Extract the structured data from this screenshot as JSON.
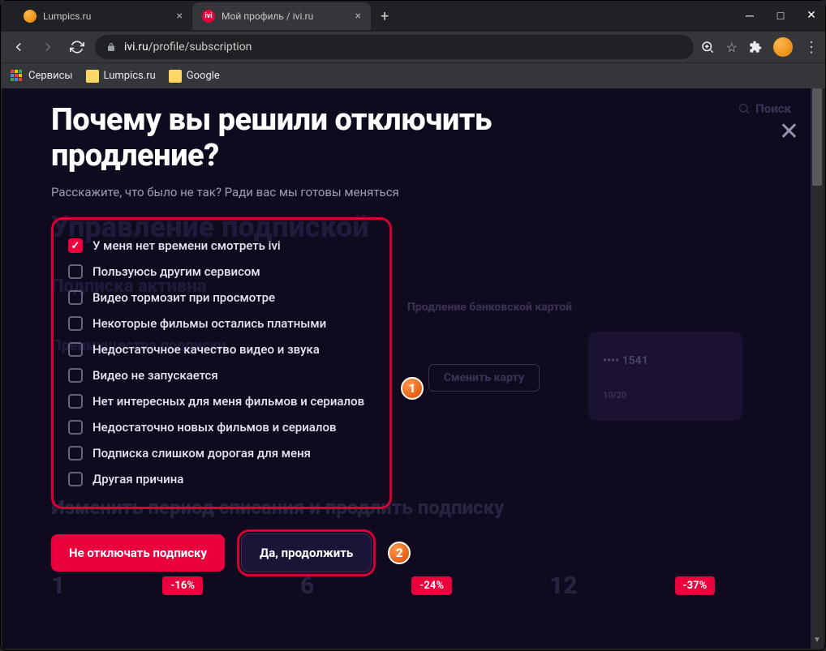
{
  "window": {
    "tabs": [
      {
        "title": "Lumpics.ru",
        "active": false
      },
      {
        "title": "Мой профиль / ivi.ru",
        "active": true
      }
    ]
  },
  "address": {
    "domain": "ivi.ru",
    "path": "/profile/subscription"
  },
  "bookmarks": {
    "apps": "Сервисы",
    "items": [
      "Lumpics.ru",
      "Google"
    ]
  },
  "bg": {
    "search": "Поиск",
    "title": "Управление подпиской",
    "active": "Подписка активна",
    "renewal": "Продление банковской картой",
    "change": "Сменить карту",
    "card_last4": "•••• 1541",
    "card_exp": "10/20",
    "advantages": "Преимущества подписки",
    "change_period": "Изменить период списания и продлить подписку",
    "promo": [
      {
        "num": "1",
        "badge": "-16%"
      },
      {
        "num": "6",
        "badge": "-24%"
      },
      {
        "num": "12",
        "badge": "-37%"
      }
    ]
  },
  "modal": {
    "title_line1": "Почему вы решили отключить",
    "title_line2": "продление?",
    "subtitle": "Расскажите, что было не так? Ради вас мы готовы меняться",
    "reasons": [
      {
        "label": "У меня нет времени смотреть ivi",
        "checked": true
      },
      {
        "label": "Пользуюсь другим сервисом",
        "checked": false
      },
      {
        "label": "Видео тормозит при просмотре",
        "checked": false
      },
      {
        "label": "Некоторые фильмы остались платными",
        "checked": false
      },
      {
        "label": "Недостаточное качество видео и звука",
        "checked": false
      },
      {
        "label": "Видео не запускается",
        "checked": false
      },
      {
        "label": "Нет интересных для меня фильмов и сериалов",
        "checked": false
      },
      {
        "label": "Недостаточно новых фильмов и сериалов",
        "checked": false
      },
      {
        "label": "Подписка слишком дорогая для меня",
        "checked": false
      },
      {
        "label": "Другая причина",
        "checked": false
      }
    ],
    "cancel_button": "Не отключать подписку",
    "continue_button": "Да, продолжить"
  },
  "annotations": {
    "b1": "1",
    "b2": "2"
  }
}
